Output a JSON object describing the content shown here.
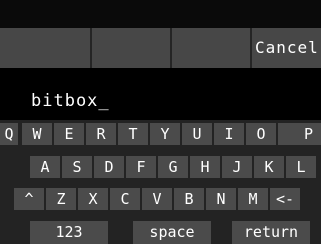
{
  "buttons": {
    "blank_1": "",
    "blank_2": "",
    "blank_3": "",
    "cancel": "Cancel"
  },
  "input": {
    "value": "bitbox_"
  },
  "keyboard": {
    "row1": [
      "Q",
      "W",
      "E",
      "R",
      "T",
      "Y",
      "U",
      "I",
      "O",
      "P"
    ],
    "row2": [
      "A",
      "S",
      "D",
      "F",
      "G",
      "H",
      "J",
      "K",
      "L"
    ],
    "row3": [
      "^",
      "Z",
      "X",
      "C",
      "V",
      "B",
      "N",
      "M",
      "<-"
    ],
    "row4": [
      "123",
      "space",
      "return"
    ]
  }
}
